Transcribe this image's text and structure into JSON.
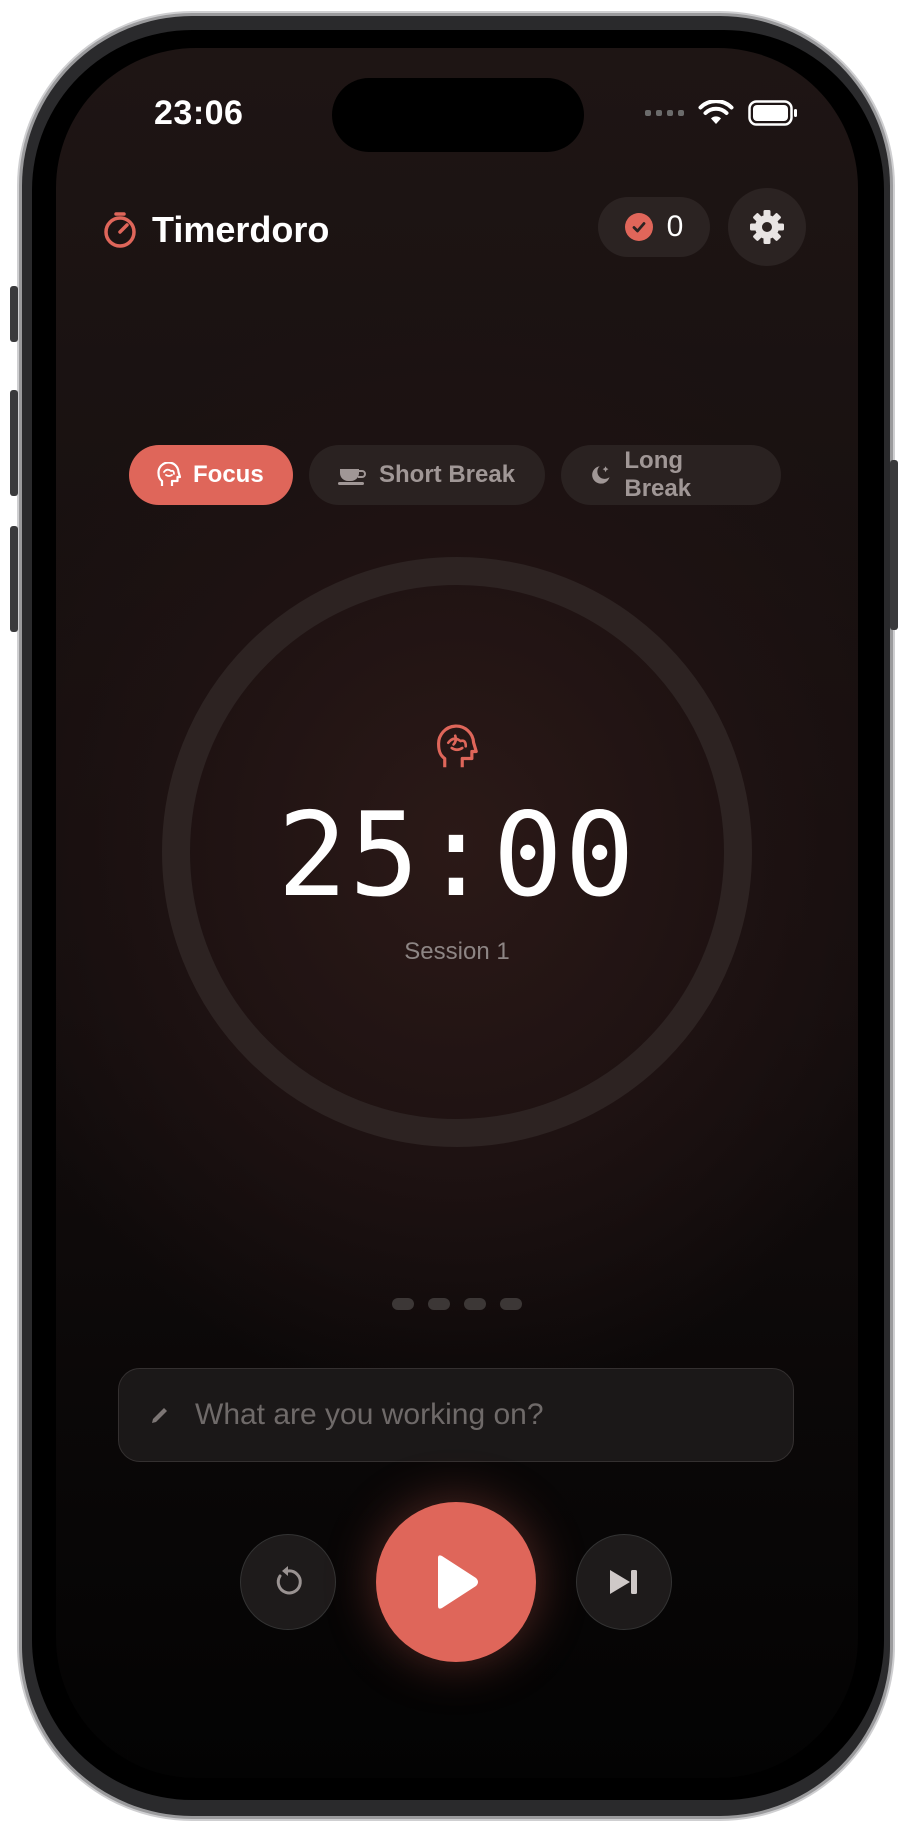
{
  "status_bar": {
    "time": "23:06"
  },
  "header": {
    "title": "Timerdoro",
    "completed_count": "0"
  },
  "modes": [
    {
      "label": "Focus",
      "icon": "brain-icon",
      "active": true
    },
    {
      "label": "Short Break",
      "icon": "coffee-cup-icon",
      "active": false
    },
    {
      "label": "Long Break",
      "icon": "moon-icon",
      "active": false
    }
  ],
  "timer": {
    "value": "25:00",
    "session_label": "Session 1",
    "progress": 0
  },
  "session_dots": {
    "total": 4,
    "completed": 0
  },
  "task": {
    "placeholder": "What are you working on?",
    "value": ""
  },
  "controls": {
    "reset": "reset-icon",
    "play": "play-icon",
    "skip": "skip-forward-icon"
  },
  "colors": {
    "accent": "#df665a",
    "background": "#1e1514",
    "pill": "#2a2221",
    "text_primary": "#ffffff",
    "text_secondary": "#8d8584"
  }
}
